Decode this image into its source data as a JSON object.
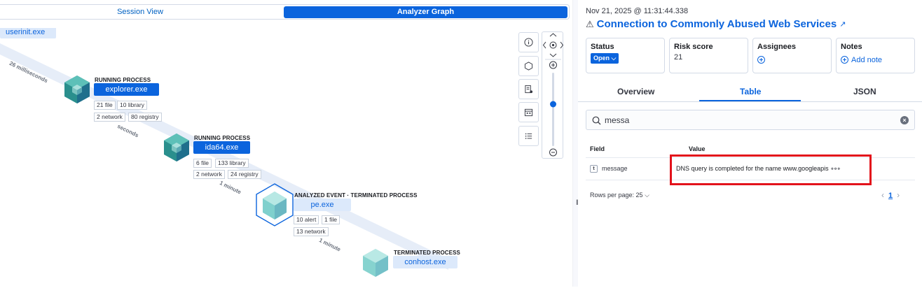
{
  "view_tabs": {
    "session": "Session View",
    "analyzer": "Analyzer Graph"
  },
  "graph": {
    "nodes": [
      {
        "name": "userinit.exe"
      },
      {
        "caption": "RUNNING PROCESS",
        "name": "explorer.exe",
        "chips": [
          "21 file",
          "10 library",
          "2 network",
          "80 registry"
        ]
      },
      {
        "caption": "RUNNING PROCESS",
        "name": "ida64.exe",
        "chips": [
          "6 file",
          "133 library",
          "2 network",
          "24 registry"
        ]
      },
      {
        "caption": "ANALYZED EVENT · TERMINATED PROCESS",
        "name": "pe.exe",
        "chips": [
          "10 alert",
          "1 file",
          "13 network"
        ]
      },
      {
        "caption": "TERMINATED PROCESS",
        "name": "conhost.exe"
      }
    ],
    "edge_labels": [
      "26 milliseconds",
      "seconds",
      "1 minute",
      "1 minute"
    ]
  },
  "flyout": {
    "timestamp": "Nov 21, 2025 @ 11:31:44.338",
    "title": "Connection to Commonly Abused Web Services",
    "cards": {
      "status": {
        "label": "Status",
        "value": "Open"
      },
      "risk": {
        "label": "Risk score",
        "value": "21"
      },
      "assignees": {
        "label": "Assignees"
      },
      "notes": {
        "label": "Notes",
        "action": "Add note"
      }
    },
    "tabs": [
      "Overview",
      "Table",
      "JSON"
    ],
    "search": {
      "value": "messa"
    },
    "table": {
      "headers": [
        "Field",
        "Value"
      ],
      "rows": [
        {
          "field": "message",
          "value": "DNS query is completed for the name www.googleapis"
        }
      ]
    },
    "pager": {
      "rows_per_page": "Rows per page: 25",
      "page": "1"
    }
  },
  "colors": {
    "primary": "#0b64dd",
    "highlight": "#e3121b"
  }
}
